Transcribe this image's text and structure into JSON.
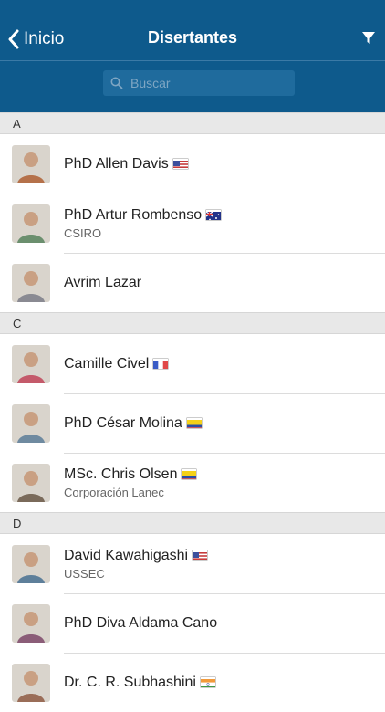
{
  "nav": {
    "back_label": "Inicio",
    "title": "Disertantes"
  },
  "search": {
    "placeholder": "Buscar"
  },
  "sections": [
    {
      "letter": "A",
      "people": [
        {
          "name": "PhD Allen Davis",
          "flag": "us",
          "org": ""
        },
        {
          "name": "PhD Artur Rombenso",
          "flag": "au",
          "org": "CSIRO"
        },
        {
          "name": "Avrim Lazar",
          "flag": "",
          "org": ""
        }
      ]
    },
    {
      "letter": "C",
      "people": [
        {
          "name": "Camille Civel",
          "flag": "fr",
          "org": ""
        },
        {
          "name": "PhD César Molina",
          "flag": "co",
          "org": ""
        },
        {
          "name": "MSc. Chris Olsen",
          "flag": "co",
          "org": "Corporación Lanec"
        }
      ]
    },
    {
      "letter": "D",
      "people": [
        {
          "name": "David Kawahigashi",
          "flag": "us",
          "org": "USSEC"
        },
        {
          "name": "PhD Diva Aldama Cano",
          "flag": "",
          "org": ""
        },
        {
          "name": "Dr. C. R. Subhashini",
          "flag": "in",
          "org": ""
        }
      ]
    }
  ],
  "colors": {
    "header": "#0e5a8c",
    "section_bg": "#e8e8e8"
  }
}
